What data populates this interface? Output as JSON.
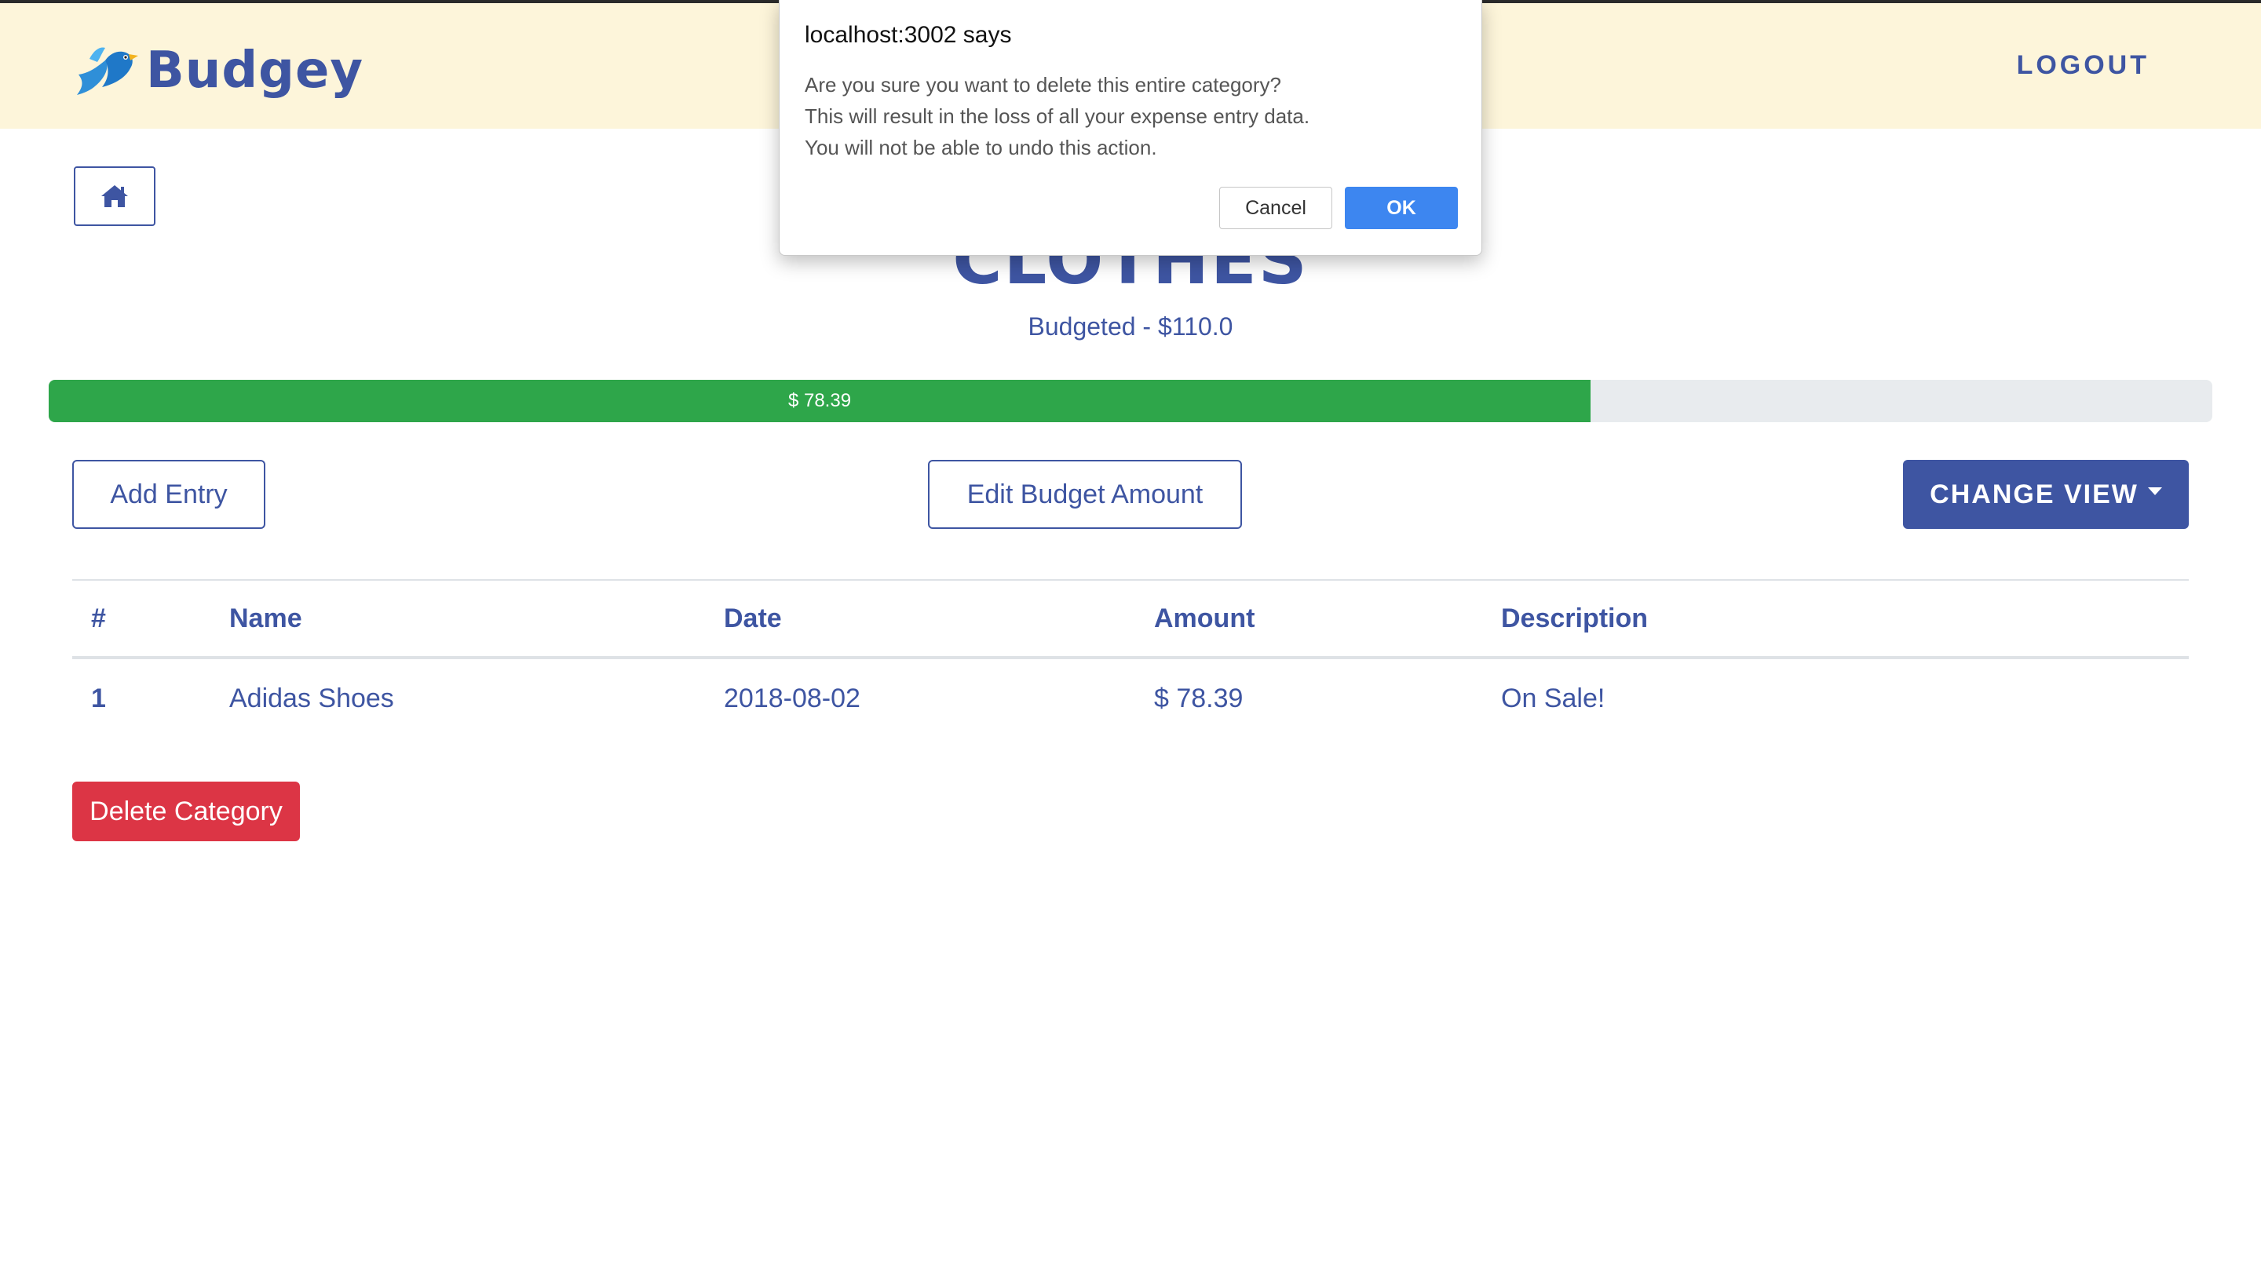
{
  "header": {
    "brand_name": "Budgey",
    "brand_icon": "bird-logo-icon",
    "logout_label": "LOGOUT"
  },
  "home_button": {
    "icon": "home-icon"
  },
  "category": {
    "title": "CLOTHES",
    "budgeted_text": "Budgeted - $110.0"
  },
  "progress": {
    "label": "$ 78.39",
    "spent": 78.39,
    "budget": 110.0
  },
  "actions": {
    "add_entry_label": "Add Entry",
    "edit_budget_label": "Edit Budget Amount",
    "change_view_label": "CHANGE VIEW"
  },
  "table": {
    "columns": [
      "#",
      "Name",
      "Date",
      "Amount",
      "Description"
    ],
    "rows": [
      {
        "num": "1",
        "name": "Adidas Shoes",
        "date": "2018-08-02",
        "amount": "$ 78.39",
        "description": "On Sale!"
      }
    ]
  },
  "delete_button_label": "Delete Category",
  "dialog": {
    "title": "localhost:3002 says",
    "message_lines": [
      "Are you sure you want to delete this entire category?",
      "This will result in the loss of all your expense entry data.",
      "You will not be able to undo this action."
    ],
    "cancel_label": "Cancel",
    "ok_label": "OK"
  },
  "colors": {
    "brand_blue": "#3e55a2",
    "header_bg": "#fdf5da",
    "progress_green": "#2ea64a",
    "danger_red": "#dc3545",
    "dialog_ok_blue": "#3d86f0"
  }
}
